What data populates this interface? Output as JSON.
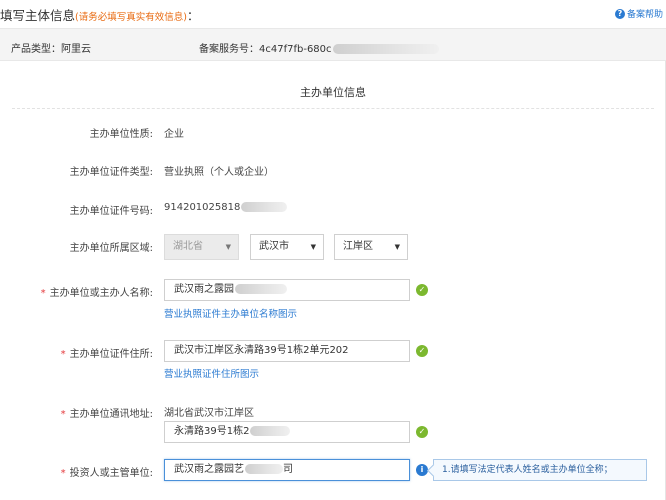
{
  "header": {
    "title": "填写主体信息",
    "hint": "(请务必填写真实有效信息)",
    "colon": "：",
    "help_label": "备案帮助"
  },
  "info_bar": {
    "product_type": "产品类型：阿里云",
    "service_no": "备案服务号：4c47f7fb-680c"
  },
  "section": {
    "title": "主办单位信息"
  },
  "fields": {
    "nature": {
      "label": "主办单位性质:",
      "value": "企业"
    },
    "cert_type": {
      "label": "主办单位证件类型:",
      "value": "营业执照（个人或企业）"
    },
    "cert_no": {
      "label": "主办单位证件号码:",
      "value": "914201025818"
    },
    "region": {
      "label": "主办单位所属区域:",
      "province": "湖北省",
      "city": "武汉市",
      "district": "江岸区"
    },
    "name": {
      "label": "主办单位或主办人名称:",
      "value": "武汉雨之露园",
      "link": "营业执照证件主办单位名称图示"
    },
    "address": {
      "label": "主办单位证件住所:",
      "value": "武汉市江岸区永清路39号1栋2单元202",
      "link": "营业执照证件住所图示"
    },
    "mail": {
      "label": "主办单位通讯地址:",
      "prefix": "湖北省武汉市江岸区",
      "value": "永清路39号1栋2"
    },
    "investor": {
      "label": "投资人或主管单位:",
      "value": "武汉雨之露园艺",
      "value_tail": "司",
      "tip": "1.请填写法定代表人姓名或主办单位全称；"
    }
  },
  "colors": {
    "accent_blue": "#2a7ad1",
    "hint_orange": "#e8690f",
    "valid_green": "#7cb82f",
    "required_red": "#e4393c"
  }
}
